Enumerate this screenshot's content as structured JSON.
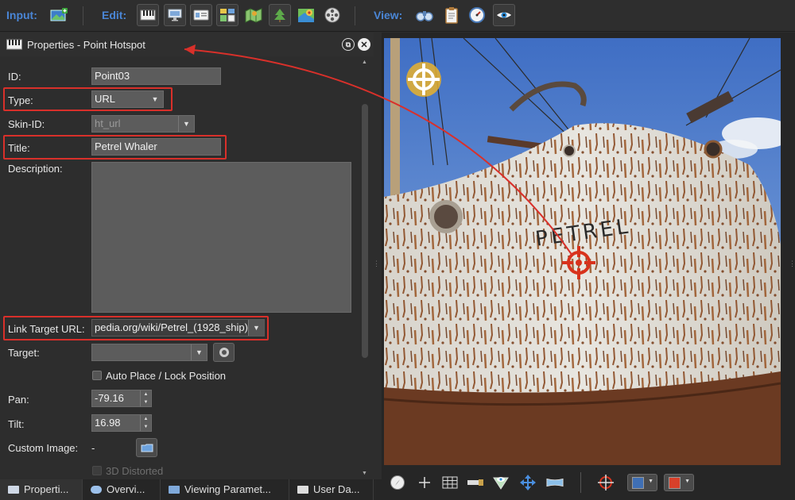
{
  "toolbar": {
    "input_label": "Input:",
    "edit_label": "Edit:",
    "view_label": "View:",
    "input_icons": [
      "add-image-icon"
    ],
    "edit_icons": [
      "piano-keys-icon",
      "monitor-icon",
      "id-card-icon",
      "layout-icon",
      "map-icon",
      "tree-icon",
      "location-map-icon",
      "film-reel-icon"
    ],
    "view_icons": [
      "binoculars-icon",
      "clipboard-icon",
      "gauge-icon",
      "eye-icon"
    ]
  },
  "panel": {
    "title": "Properties - Point Hotspot",
    "id_label": "ID:",
    "id_value": "Point03",
    "type_label": "Type:",
    "type_value": "URL",
    "skin_label": "Skin-ID:",
    "skin_value": "ht_url",
    "title_label": "Title:",
    "title_value": "Petrel Whaler",
    "description_label": "Description:",
    "description_value": "",
    "url_label": "Link Target URL:",
    "url_value": "pedia.org/wiki/Petrel_(1928_ship)",
    "target_label": "Target:",
    "target_value": "",
    "autoplace_label": "Auto Place / Lock Position",
    "pan_label": "Pan:",
    "pan_value": "-79.16",
    "tilt_label": "Tilt:",
    "tilt_value": "16.98",
    "custom_image_label": "Custom Image:",
    "custom_image_value": "-",
    "distorted_label": "3D Distorted"
  },
  "tabs": [
    {
      "label": "Properti...",
      "icon": "properties-icon"
    },
    {
      "label": "Overvi...",
      "icon": "binoculars-icon"
    },
    {
      "label": "Viewing Paramet...",
      "icon": "monitor-icon"
    },
    {
      "label": "User Da...",
      "icon": "user-data-icon"
    }
  ],
  "photo": {
    "ship_name": "PETREL"
  },
  "colors": {
    "accent_blue": "#4a86d6",
    "highlight_red": "#d9302a",
    "hotspot_yellow": "#e9b12c",
    "hotspot_red": "#d8321c",
    "swatch_blue": "#3f6fb4",
    "swatch_red": "#d8402a"
  },
  "viewer_toolbar": {
    "icons": [
      "compass-icon",
      "crosshair-plus-icon",
      "grid-icon",
      "key-icon",
      "eye-cone-icon",
      "move-arrows-icon",
      "panorama-icon",
      "target-icon",
      "blue-swatch-button",
      "red-swatch-button"
    ]
  }
}
